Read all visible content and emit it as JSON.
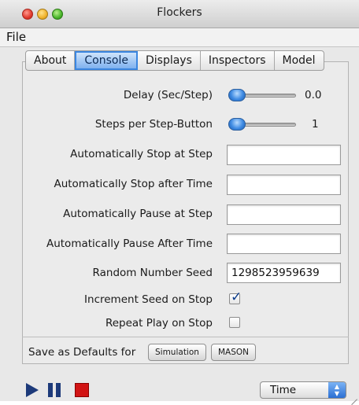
{
  "window": {
    "title": "Flockers"
  },
  "menubar": {
    "file": "File"
  },
  "tabs": [
    {
      "label": "About",
      "active": false
    },
    {
      "label": "Console",
      "active": true
    },
    {
      "label": "Displays",
      "active": false
    },
    {
      "label": "Inspectors",
      "active": false
    },
    {
      "label": "Model",
      "active": false
    }
  ],
  "console": {
    "delay": {
      "label": "Delay (Sec/Step)",
      "value": "0.0",
      "slider_fraction": 0
    },
    "steps_per_button": {
      "label": "Steps per Step-Button",
      "value": "1",
      "slider_fraction": 0
    },
    "auto_stop_step": {
      "label": "Automatically Stop at Step",
      "value": ""
    },
    "auto_stop_time": {
      "label": "Automatically Stop after Time",
      "value": ""
    },
    "auto_pause_step": {
      "label": "Automatically Pause at Step",
      "value": ""
    },
    "auto_pause_time": {
      "label": "Automatically Pause After Time",
      "value": ""
    },
    "seed": {
      "label": "Random Number Seed",
      "value": "1298523959639"
    },
    "increment_seed": {
      "label": "Increment Seed on Stop",
      "checked": true
    },
    "repeat_play": {
      "label": "Repeat Play on Stop",
      "checked": false
    },
    "defaults": {
      "label": "Save as Defaults for",
      "simulation_button": "Simulation",
      "mason_button": "MASON"
    }
  },
  "controls": {
    "play_icon": "play-icon",
    "pause_icon": "pause-icon",
    "stop_icon": "stop-icon",
    "time_select": "Time"
  },
  "colors": {
    "accent": "#3b86e0",
    "stop": "#d11414",
    "transport": "#1d3a7a"
  }
}
